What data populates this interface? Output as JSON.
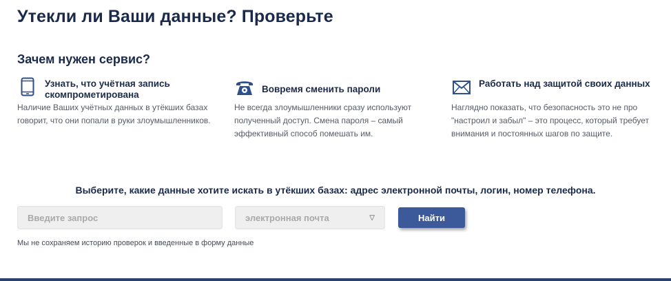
{
  "page": {
    "title": "Утекли ли Ваши данные? Проверьте",
    "section_title": "Зачем нужен сервис?"
  },
  "features": [
    {
      "icon": "smartphone-icon",
      "title": "Узнать, что учётная запись скомпрометирована",
      "description": "Наличие Ваших учётных данных в утёкших базах говорит, что они попали в руки злоумышленников."
    },
    {
      "icon": "telephone-icon",
      "title": "Вовремя сменить пароли",
      "description": "Не всегда злоумышленники сразу используют полученный доступ. Смена пароля – самый эффективный способ помешать им."
    },
    {
      "icon": "envelope-icon",
      "title": "Работать над защитой своих данных",
      "description": "Наглядно показать, что безопасность это не про \"настроил и забыл\" – это процесс, который требует внимания и постоянных шагов по защите."
    }
  ],
  "search": {
    "prompt": "Выберите, какие данные хотите искать в утёкших базах: адрес электронной почты, логин, номер телефона.",
    "input_placeholder": "Введите запрос",
    "input_value": "",
    "type_selected": "электронная почта",
    "submit_label": "Найти",
    "privacy_note": "Мы не сохраняем историю проверок и введенные в форму данные"
  },
  "colors": {
    "heading": "#1b2a4a",
    "accent": "#3c5a9a",
    "icon": "#2d4f8a",
    "bottom_bar": "#2d4170"
  }
}
